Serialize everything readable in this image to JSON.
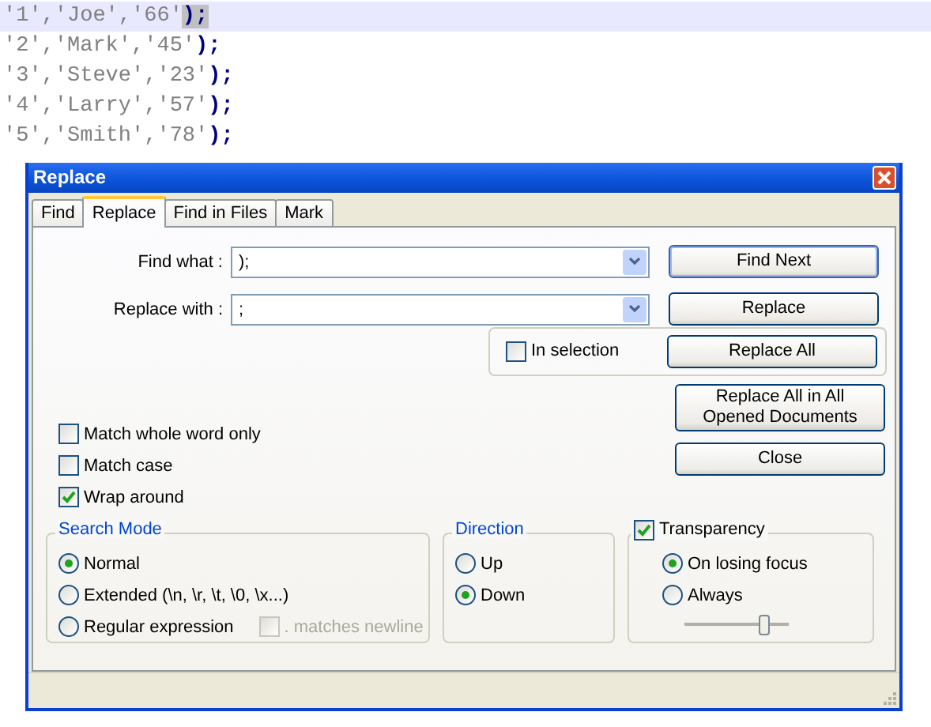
{
  "editor": {
    "lines": [
      {
        "values": "'1','Joe','66'",
        "closing": ");",
        "current": true,
        "brace_highlight": true
      },
      {
        "values": "'2','Mark','45'",
        "closing": ");",
        "current": false,
        "brace_highlight": false
      },
      {
        "values": "'3','Steve','23'",
        "closing": ");",
        "current": false,
        "brace_highlight": false
      },
      {
        "values": "'4','Larry','57'",
        "closing": ");",
        "current": false,
        "brace_highlight": false
      },
      {
        "values": "'5','Smith','78'",
        "closing": ");",
        "current": false,
        "brace_highlight": false
      }
    ]
  },
  "dialog": {
    "title": "Replace",
    "tabs": [
      {
        "label": "Find",
        "selected": false
      },
      {
        "label": "Replace",
        "selected": true
      },
      {
        "label": "Find in Files",
        "selected": false
      },
      {
        "label": "Mark",
        "selected": false
      }
    ],
    "fields": [
      {
        "label": "Find what :",
        "value": ");"
      },
      {
        "label": "Replace with :",
        "value": ";"
      }
    ],
    "in_selection": {
      "label": "In selection",
      "checked": false
    },
    "buttons": [
      "Find Next",
      "Replace",
      "Replace All",
      "Replace All in All Opened Documents",
      "Close"
    ],
    "options": [
      {
        "label": "Match whole word only",
        "checked": false
      },
      {
        "label": "Match case",
        "checked": false
      },
      {
        "label": "Wrap around",
        "checked": true
      }
    ],
    "search_mode": {
      "title": "Search Mode",
      "modes": [
        {
          "label": "Normal",
          "selected": true
        },
        {
          "label": "Extended (\\n, \\r, \\t, \\0, \\x...)",
          "selected": false
        },
        {
          "label": "Regular expression",
          "selected": false
        }
      ],
      "dot_newline": {
        "label": ". matches newline",
        "checked": false,
        "disabled": true
      }
    },
    "direction": {
      "title": "Direction",
      "options": [
        {
          "label": "Up",
          "selected": false
        },
        {
          "label": "Down",
          "selected": true
        }
      ]
    },
    "transparency": {
      "label": "Transparency",
      "checked": true,
      "options": [
        {
          "label": "On losing focus",
          "selected": true
        },
        {
          "label": "Always",
          "selected": false
        }
      ],
      "level": 0.75
    }
  }
}
